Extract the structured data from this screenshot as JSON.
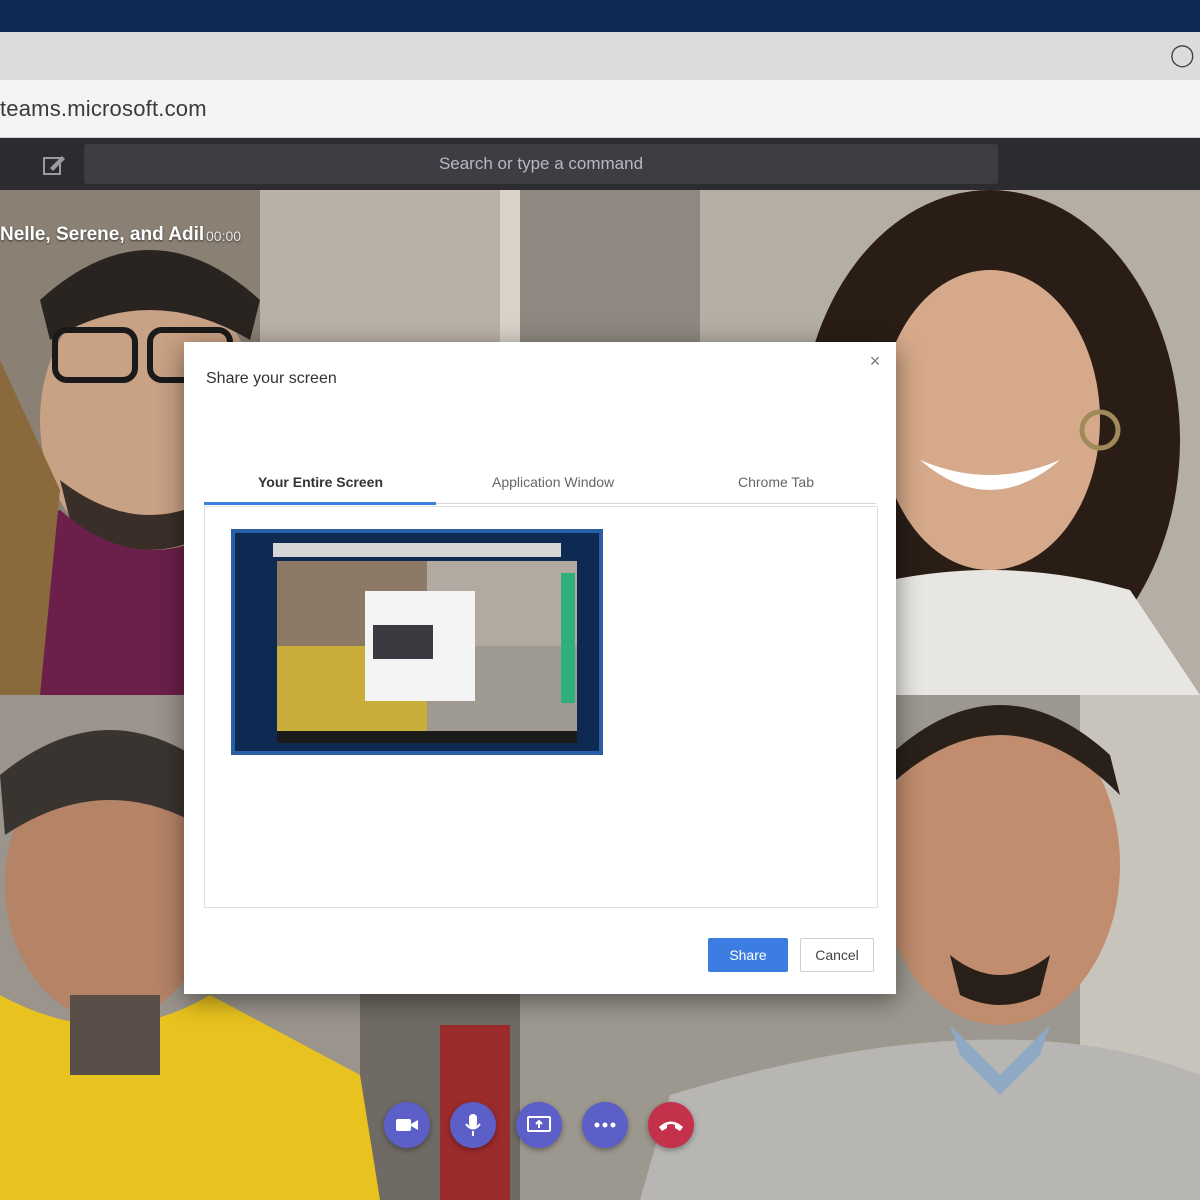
{
  "browser": {
    "url": "teams.microsoft.com",
    "shield_icon": "browser-extension-icon"
  },
  "teams": {
    "search_placeholder": "Search or type a command",
    "compose_icon": "compose-icon"
  },
  "meeting": {
    "title": "Nelle, Serene, and Adil",
    "timer": "00:00"
  },
  "dialog": {
    "title": "Share your screen",
    "tabs": [
      {
        "label": "Your Entire Screen",
        "active": true
      },
      {
        "label": "Application Window",
        "active": false
      },
      {
        "label": "Chrome Tab",
        "active": false
      }
    ],
    "share_label": "Share",
    "cancel_label": "Cancel",
    "accent": "#3b7de0"
  },
  "controls": [
    {
      "name": "camera-icon"
    },
    {
      "name": "microphone-icon"
    },
    {
      "name": "share-screen-icon"
    },
    {
      "name": "more-options-icon"
    },
    {
      "name": "hang-up-icon",
      "color": "#c4314b"
    }
  ],
  "colors": {
    "teams_purple": "#5b5fc7",
    "os_bar": "#0f2a52"
  }
}
